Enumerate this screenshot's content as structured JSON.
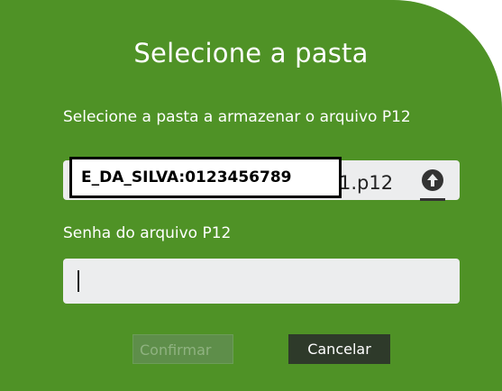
{
  "dialog": {
    "title": "Selecione a pasta",
    "folder_label": "Selecione a pasta a armazenar o arquivo P12",
    "file_field": {
      "visible_suffix": "1.p12",
      "tooltip_text": "E_DA_SILVA:0123456789"
    },
    "password_label": "Senha do arquivo P12",
    "password_value": "",
    "confirm_label": "Confirmar",
    "cancel_label": "Cancelar",
    "icons": [
      "upload-icon"
    ],
    "colors": {
      "panel": "#4f9226",
      "field": "#ecedee",
      "cancel_button": "#2e3a2a",
      "confirm_button_disabled": "#5e8e4a"
    }
  }
}
